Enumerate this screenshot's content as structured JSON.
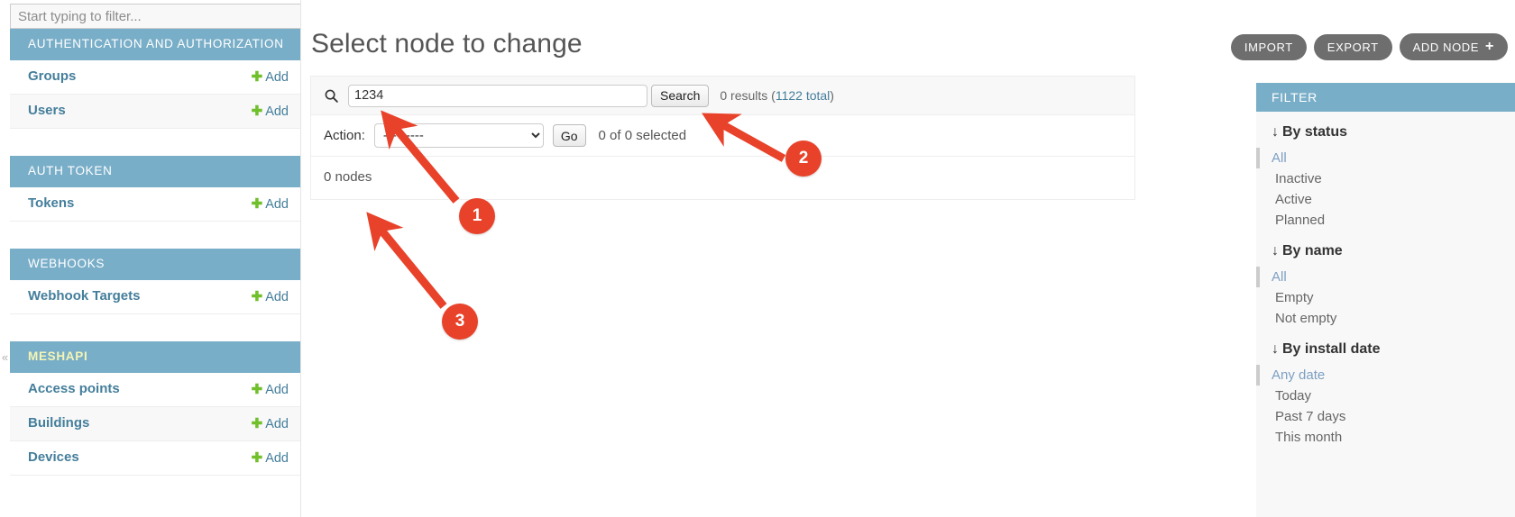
{
  "nav": {
    "filter_placeholder": "Start typing to filter...",
    "filter_value": "",
    "collapse_glyph": "«",
    "add_label": "Add",
    "apps": [
      {
        "caption": "AUTHENTICATION AND AUTHORIZATION",
        "current": false,
        "models": [
          {
            "name": "Groups",
            "add": "Add"
          },
          {
            "name": "Users",
            "add": "Add"
          }
        ]
      },
      {
        "caption": "AUTH TOKEN",
        "current": false,
        "models": [
          {
            "name": "Tokens",
            "add": "Add"
          }
        ]
      },
      {
        "caption": "WEBHOOKS",
        "current": false,
        "models": [
          {
            "name": "Webhook Targets",
            "add": "Add"
          }
        ]
      },
      {
        "caption": "MESHAPI",
        "current": true,
        "models": [
          {
            "name": "Access points",
            "add": "Add"
          },
          {
            "name": "Buildings",
            "add": "Add"
          },
          {
            "name": "Devices",
            "add": "Add"
          }
        ]
      }
    ]
  },
  "object_tools": [
    {
      "label": "Import",
      "icon": null
    },
    {
      "label": "Export",
      "icon": null
    },
    {
      "label": "Add node",
      "icon": "plus-icon"
    }
  ],
  "main": {
    "title": "Select node to change",
    "search": {
      "icon": "search-icon",
      "value": "1234",
      "placeholder": "",
      "submit_label": "Search",
      "result_text": "0 results (",
      "result_link": "1122 total",
      "result_text_end": ")"
    },
    "actions": {
      "label": "Action:",
      "selected": "---------",
      "options": [
        "---------"
      ],
      "go_label": "Go",
      "counter": "0 of 0 selected"
    },
    "paginator": "0 nodes"
  },
  "filter_panel": {
    "title": "Filter",
    "arrow_glyph": "↓",
    "groups": [
      {
        "heading": "By status",
        "options": [
          {
            "label": "All",
            "selected": true
          },
          {
            "label": "Inactive",
            "selected": false
          },
          {
            "label": "Active",
            "selected": false
          },
          {
            "label": "Planned",
            "selected": false
          }
        ]
      },
      {
        "heading": "By name",
        "options": [
          {
            "label": "All",
            "selected": true
          },
          {
            "label": "Empty",
            "selected": false
          },
          {
            "label": "Not empty",
            "selected": false
          }
        ]
      },
      {
        "heading": "By install date",
        "options": [
          {
            "label": "Any date",
            "selected": true
          },
          {
            "label": "Today",
            "selected": false
          },
          {
            "label": "Past 7 days",
            "selected": false
          },
          {
            "label": "This month",
            "selected": false
          }
        ]
      }
    ]
  },
  "annotations": {
    "color": "#e8422a",
    "markers": [
      {
        "number": "1",
        "target": "search-input"
      },
      {
        "number": "2",
        "target": "search-result-count"
      },
      {
        "number": "3",
        "target": "paginator-count"
      }
    ]
  }
}
